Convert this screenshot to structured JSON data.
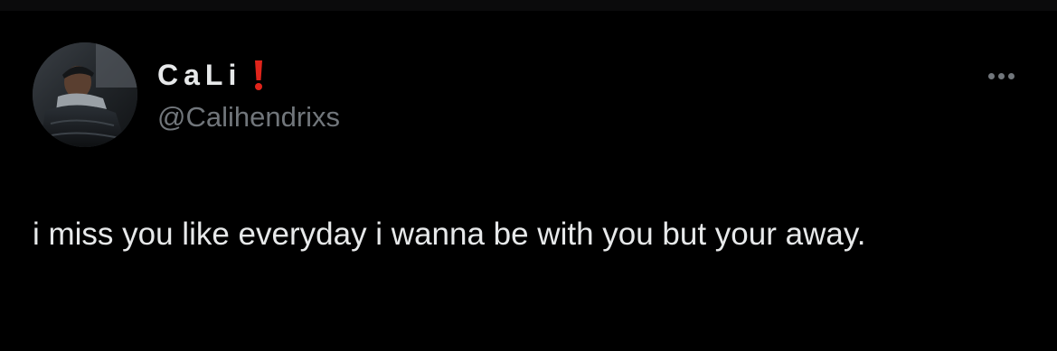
{
  "tweet": {
    "author": {
      "display_name": "CaLi",
      "badge_icon": "exclamation-mark-icon",
      "badge_color": "#e0241b",
      "handle": "@Calihendrixs"
    },
    "text": "i miss you like everyday i wanna be with you but your away.",
    "more_icon": "more-horizontal-icon"
  },
  "colors": {
    "background": "#000000",
    "primary_text": "#e7e9ea",
    "secondary_text": "#71767b"
  }
}
